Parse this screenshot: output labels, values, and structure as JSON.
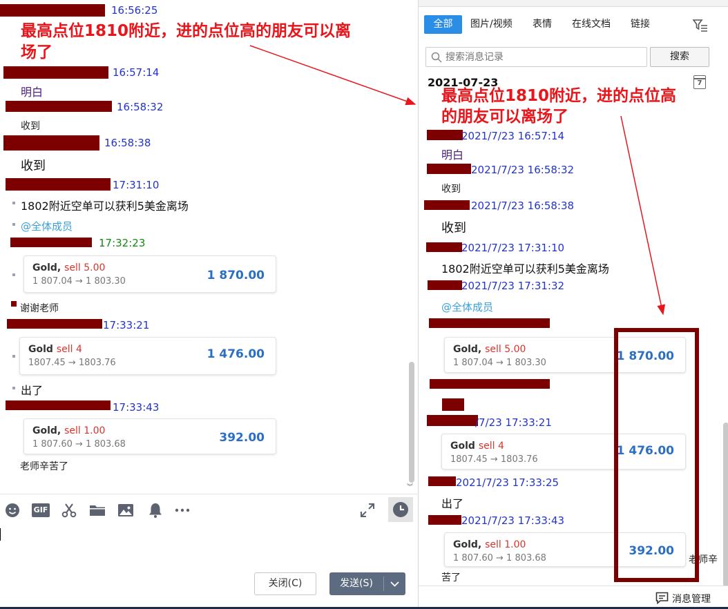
{
  "annotation": {
    "banner_line1": "最高点位1810附近，进的点位高的朋友可以离",
    "banner_line2": "场了",
    "right_banner_line1": "最高点位1810附近，进的点位高",
    "right_banner_line2": "的朋友可以离场了",
    "color": "#e8161b",
    "box_color": "#7c0000"
  },
  "chat": {
    "messages": [
      {
        "time": "16:56:25"
      },
      {
        "time": "16:57:14",
        "text": "明白"
      },
      {
        "time": "16:58:32",
        "text": "收到"
      },
      {
        "time": "16:58:38",
        "text": "收到"
      },
      {
        "time": "17:31:10",
        "text": "1802附近空单可以获利5美金离场",
        "mention": "@全体成员"
      },
      {
        "time": "17:32:23",
        "card": {
          "label": "Gold,",
          "action": "sell 5.00",
          "range": "1 807.04 → 1 803.30",
          "price": "1 870.00"
        }
      },
      {
        "text": "谢谢老师"
      },
      {
        "time": "17:33:21",
        "card": {
          "label": "Gold",
          "action": "sell 4",
          "range": "1807.45 → 1803.76",
          "price": "1 476.00"
        },
        "text": "出了"
      },
      {
        "time": "17:33:43",
        "card": {
          "label": "Gold,",
          "action": "sell 1.00",
          "range": "1 807.60 → 1 803.68",
          "price": "392.00"
        },
        "text": "老师辛苦了"
      }
    ],
    "toolbar": [
      "emoji-icon",
      "gif-icon",
      "scissors-icon",
      "folder-icon",
      "image-icon",
      "bell-icon",
      "more-icon",
      "expand-icon",
      "clock-icon"
    ],
    "gif_label": "GIF",
    "close_button": "关闭(C)",
    "send_button": "发送(S)"
  },
  "history": {
    "tabs": [
      "全部",
      "图片/视频",
      "表情",
      "在线文档",
      "链接"
    ],
    "search_placeholder": "搜索消息记录",
    "search_button": "搜索",
    "date": "2021-07-23",
    "calendar_day": "7",
    "messages": [
      {
        "time": "2021/7/23 16:57:14",
        "text": "明白"
      },
      {
        "time": "2021/7/23 16:58:32",
        "text": "收到"
      },
      {
        "time": "2021/7/23 16:58:38",
        "text": "收到"
      },
      {
        "time": "2021/7/23 17:31:10",
        "text": "1802附近空单可以获利5美金离场"
      },
      {
        "time": "2021/7/23 17:31:32",
        "text": "@全体成员"
      },
      {
        "card": {
          "label": "Gold,",
          "action": "sell 5.00",
          "range": "1 807.04 → 1 803.30",
          "price": "1 870.00"
        }
      },
      {
        "time": "/7/23 17:33:21",
        "card": {
          "label": "Gold",
          "action": "sell 4",
          "range": "1807.45 → 1803.76",
          "price": "1 476.00"
        }
      },
      {
        "time": "2021/7/23 17:33:25",
        "text": "出了"
      },
      {
        "time": "2021/7/23 17:33:43",
        "card": {
          "label": "Gold,",
          "action": "sell 1.00",
          "range": "1 807.60 → 1 803.68",
          "price": "392.00"
        }
      },
      {
        "text_a": "老师辛",
        "text_b": "苦了"
      }
    ],
    "footer_label": "消息管理"
  }
}
